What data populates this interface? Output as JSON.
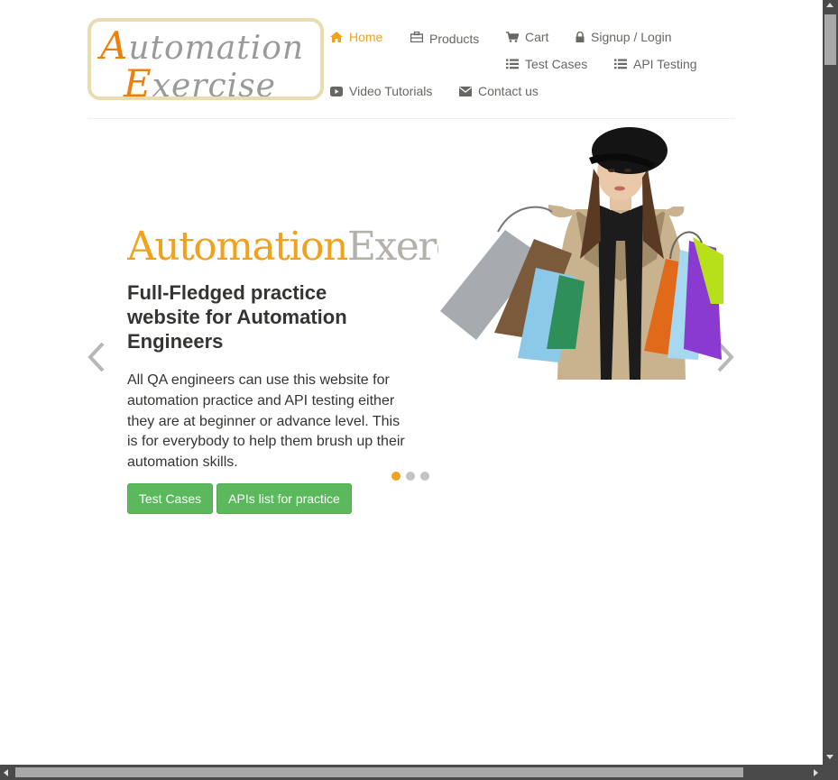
{
  "logo": {
    "line1_cap": "A",
    "line1_rest": "utomation",
    "line2_cap": "E",
    "line2_rest": "xercise"
  },
  "nav": {
    "home": "Home",
    "products": "Products",
    "cart": "Cart",
    "signup": "Signup / Login",
    "test_cases": "Test Cases",
    "api_testing": "API Testing",
    "video_tutorials": "Video Tutorials",
    "contact": "Contact us"
  },
  "hero": {
    "title_part1": "Automation",
    "title_part2": "Exercise",
    "subtitle": "Full-Fledged practice website for Automation Engineers",
    "description": "All QA engineers can use this website for automation practice and API testing either they are at beginner or advance level. This is for everybody to help them brush up their automation skills.",
    "btn_test_cases": "Test Cases",
    "btn_apis": "APIs list for practice",
    "active_slide": 1,
    "slide_count": 3
  },
  "colors": {
    "accent": "#f0a21b",
    "button": "#5cb85c",
    "text": "#696763",
    "heading": "#363432"
  },
  "icons": {
    "home": "home-icon",
    "products": "briefcase-icon",
    "cart": "shopping-cart-icon",
    "signup": "lock-icon",
    "test_cases": "list-icon",
    "api_testing": "list-icon",
    "video": "youtube-play-icon",
    "contact": "envelope-icon"
  }
}
